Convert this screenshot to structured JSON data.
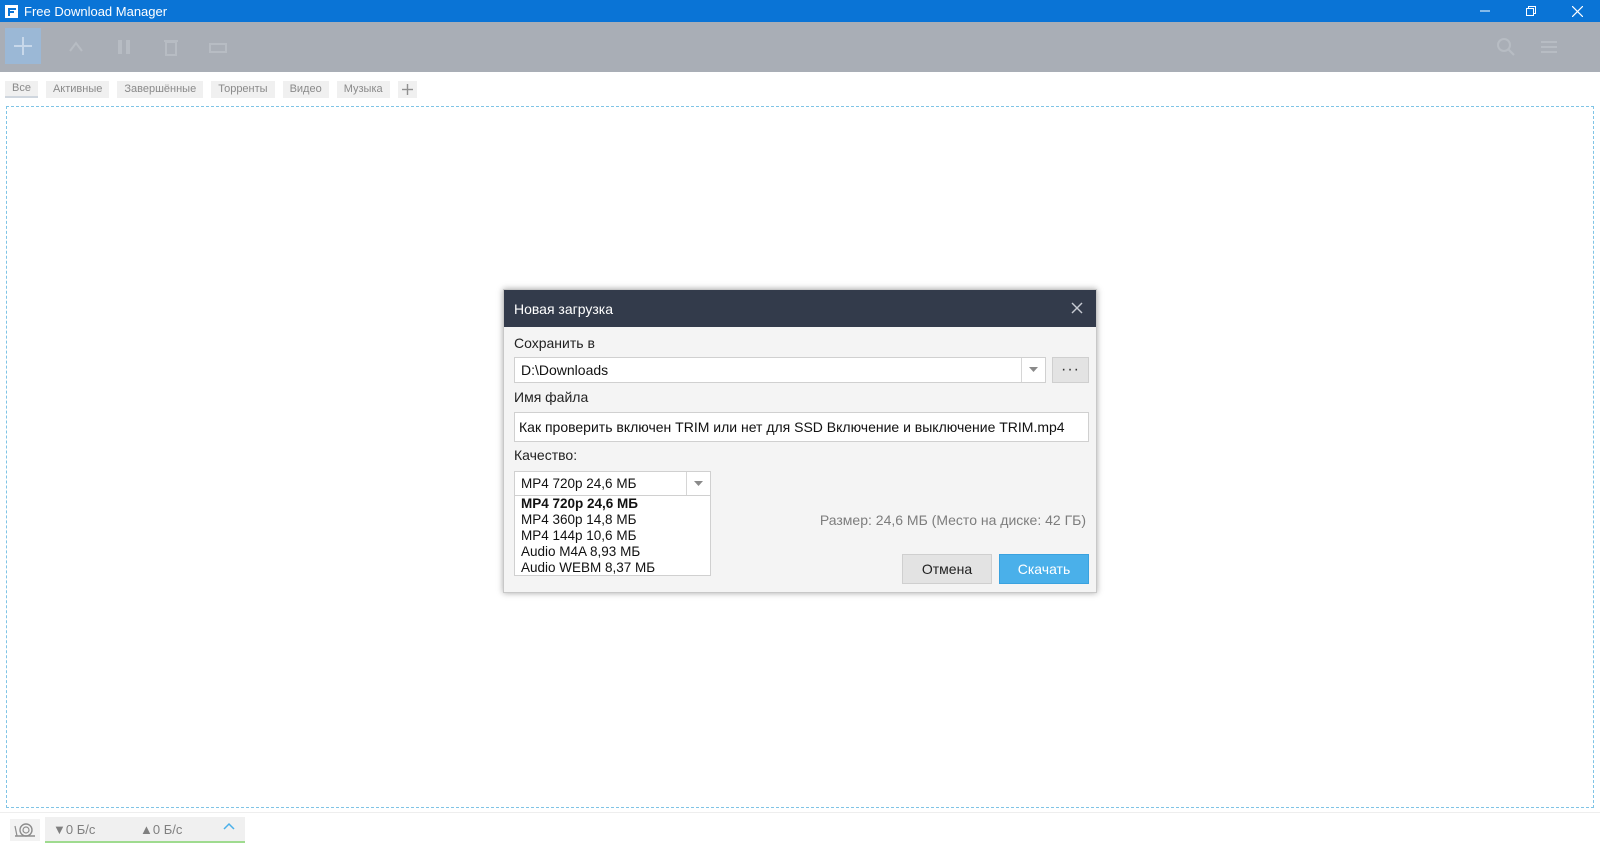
{
  "window": {
    "title": "Free Download Manager"
  },
  "tabs": [
    {
      "label": "Все"
    },
    {
      "label": "Активные"
    },
    {
      "label": "Завершённые"
    },
    {
      "label": "Торренты"
    },
    {
      "label": "Видео"
    },
    {
      "label": "Музыка"
    }
  ],
  "statusbar": {
    "download_speed": "▼0 Б/с",
    "upload_speed": "▲0 Б/с"
  },
  "dialog": {
    "title": "Новая загрузка",
    "save_to_label": "Сохранить в",
    "save_path": "D:\\Downloads",
    "browse_label": "···",
    "filename_label": "Имя файла",
    "filename": "Как проверить включен TRIM или нет для SSD Включение и выключение TRIM.mp4",
    "quality_label": "Качество:",
    "quality_selected": "MP4 720p 24,6 МБ",
    "quality_options": [
      "MP4 720p 24,6 МБ",
      "MP4 360p 14,8 МБ",
      "MP4 144p 10,6 МБ",
      "Audio M4A  8,93 МБ",
      "Audio WEBM  8,37 МБ"
    ],
    "size_info": "Размер: 24,6 МБ (Место на диске: 42 ГБ)",
    "cancel_label": "Отмена",
    "download_label": "Скачать"
  },
  "colors": {
    "titlebar": "#0a74d6",
    "dialog_header": "#333b4b",
    "download_button": "#4ab0ea",
    "drop_border": "#7fc4e6"
  },
  "icons": {
    "app": "fdm-logo-icon",
    "minimize": "minimize-icon",
    "restore": "restore-icon",
    "close": "close-icon",
    "add": "plus-icon",
    "search": "search-icon",
    "menu": "hamburger-menu-icon",
    "snail": "snail-icon",
    "chevron": "chevron-up-icon"
  }
}
